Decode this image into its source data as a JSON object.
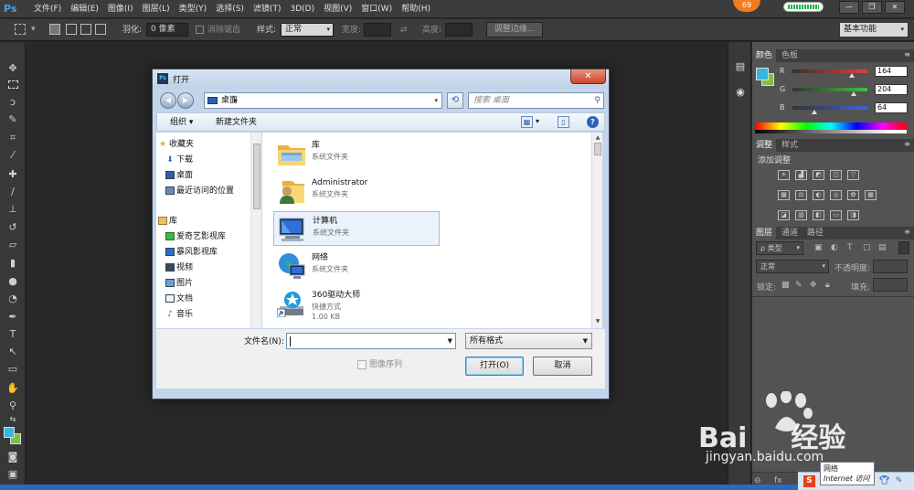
{
  "app": {
    "logo": "Ps",
    "menu": [
      "文件(F)",
      "编辑(E)",
      "图像(I)",
      "图层(L)",
      "类型(Y)",
      "选择(S)",
      "滤镜(T)",
      "3D(D)",
      "视图(V)",
      "窗口(W)",
      "帮助(H)"
    ],
    "badge": "69",
    "window_controls": [
      "—",
      "❐",
      "✕"
    ]
  },
  "options_bar": {
    "feather_label": "羽化:",
    "feather_value": "0 像素",
    "antialias_label": "消除锯齿",
    "style_label": "样式:",
    "style_value": "正常",
    "width_label": "宽度:",
    "height_label": "高度:",
    "refine_edge_label": "调整边缘...",
    "workspace": "基本功能"
  },
  "tools": [
    "move-tool",
    "marquee-tool",
    "lasso-tool",
    "quick-select-tool",
    "crop-tool",
    "eyedropper-tool",
    "healing-brush-tool",
    "brush-tool",
    "clone-stamp-tool",
    "history-brush-tool",
    "eraser-tool",
    "gradient-tool",
    "blur-tool",
    "dodge-tool",
    "pen-tool",
    "type-tool",
    "path-select-tool",
    "shape-tool",
    "hand-tool",
    "zoom-tool"
  ],
  "colors": {
    "foreground": "#39b6e0",
    "background": "#7cc143"
  },
  "color_panel": {
    "tabs": [
      "颜色",
      "色板"
    ],
    "channels": [
      {
        "label": "R",
        "value": "164",
        "color": "#e04040"
      },
      {
        "label": "G",
        "value": "204",
        "color": "#40c040"
      },
      {
        "label": "B",
        "value": "64",
        "color": "#4060e0"
      }
    ]
  },
  "adjustments_panel": {
    "tabs": [
      "调整",
      "样式"
    ],
    "title": "添加调整"
  },
  "layers_panel": {
    "tabs": [
      "图层",
      "通道",
      "路径"
    ],
    "kind_filter": "ρ 类型",
    "blend_mode": "正常",
    "opacity_label": "不透明度:",
    "lock_label": "锁定:",
    "fill_label": "填充:"
  },
  "dialog": {
    "title": "打开",
    "close_label": "✕",
    "address": "桌面",
    "search_placeholder": "搜索 桌面",
    "organize_label": "组织 ▾",
    "new_folder_label": "新建文件夹",
    "nav": {
      "favorites_header": "收藏夹",
      "favorites": [
        "下载",
        "桌面",
        "最近访问的位置"
      ],
      "libraries_header": "库",
      "libraries": [
        "爱奇艺影视库",
        "暴风影视库",
        "视频",
        "图片",
        "文档",
        "音乐"
      ]
    },
    "files": [
      {
        "name": "库",
        "type": "系统文件夹",
        "size": "",
        "icon": "library-icon",
        "selected": false
      },
      {
        "name": "Administrator",
        "type": "系统文件夹",
        "size": "",
        "icon": "user-folder-icon",
        "selected": false
      },
      {
        "name": "计算机",
        "type": "系统文件夹",
        "size": "",
        "icon": "computer-icon",
        "selected": true
      },
      {
        "name": "网络",
        "type": "系统文件夹",
        "size": "",
        "icon": "network-icon",
        "selected": false
      },
      {
        "name": "360驱动大师",
        "type": "快捷方式",
        "size": "1.00 KB",
        "icon": "driver-master-icon",
        "selected": false
      }
    ],
    "filename_label": "文件名(N):",
    "filename_value": "",
    "format_value": "所有格式",
    "image_sequence_label": "图像序列",
    "open_label": "打开(O)",
    "cancel_label": "取消"
  },
  "watermark": {
    "brand": "Bai",
    "brand_tail": "经验",
    "url": "jingyan.baidu.com"
  },
  "tray": {
    "tooltip_line1": "网络",
    "tooltip_line2": "Internet 访问"
  }
}
